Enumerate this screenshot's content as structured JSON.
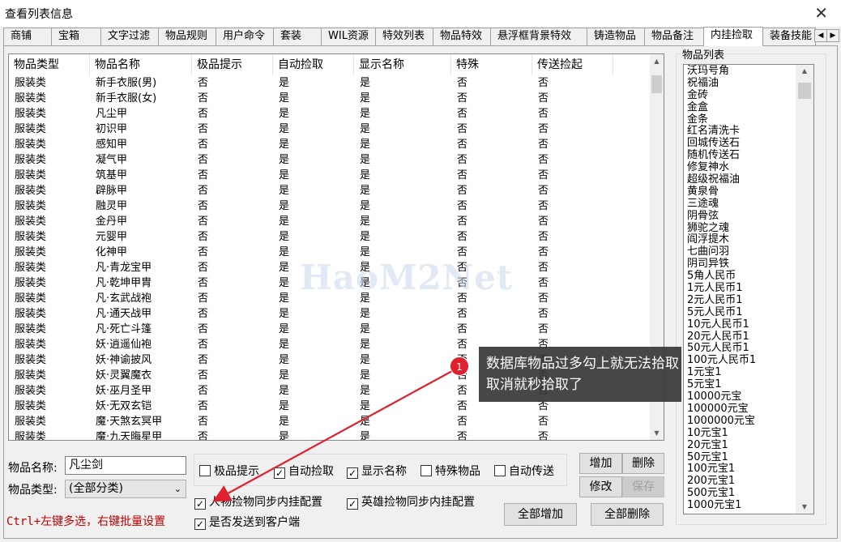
{
  "window": {
    "title": "查看列表信息",
    "close_glyph": "✕"
  },
  "tabs": [
    "商铺",
    "宝箱",
    "文字过滤",
    "物品规则",
    "用户命令",
    "套装",
    "WIL资源",
    "特效列表",
    "物品特效",
    "悬浮框背景特效",
    "铸造物品",
    "物品备注",
    "内挂捡取",
    "装备技能"
  ],
  "active_tab": "内挂捡取",
  "table": {
    "columns": [
      "物品类型",
      "物品名称",
      "极品提示",
      "自动捡取",
      "显示名称",
      "特殊",
      "传送捡起"
    ],
    "rows": [
      [
        "服装类",
        "新手衣服(男)",
        "否",
        "是",
        "是",
        "否",
        "否"
      ],
      [
        "服装类",
        "新手衣服(女)",
        "否",
        "是",
        "是",
        "否",
        "否"
      ],
      [
        "服装类",
        "凡尘甲",
        "否",
        "是",
        "是",
        "否",
        "否"
      ],
      [
        "服装类",
        "初识甲",
        "否",
        "是",
        "是",
        "否",
        "否"
      ],
      [
        "服装类",
        "感知甲",
        "否",
        "是",
        "是",
        "否",
        "否"
      ],
      [
        "服装类",
        "凝气甲",
        "否",
        "是",
        "是",
        "否",
        "否"
      ],
      [
        "服装类",
        "筑基甲",
        "否",
        "是",
        "是",
        "否",
        "否"
      ],
      [
        "服装类",
        "辟脉甲",
        "否",
        "是",
        "是",
        "否",
        "否"
      ],
      [
        "服装类",
        "融灵甲",
        "否",
        "是",
        "是",
        "否",
        "否"
      ],
      [
        "服装类",
        "金丹甲",
        "否",
        "是",
        "是",
        "否",
        "否"
      ],
      [
        "服装类",
        "元婴甲",
        "否",
        "是",
        "是",
        "否",
        "否"
      ],
      [
        "服装类",
        "化神甲",
        "否",
        "是",
        "是",
        "否",
        "否"
      ],
      [
        "服装类",
        "凡·青龙宝甲",
        "否",
        "是",
        "是",
        "否",
        "否"
      ],
      [
        "服装类",
        "凡·乾坤甲胄",
        "否",
        "是",
        "是",
        "否",
        "否"
      ],
      [
        "服装类",
        "凡·玄武战袍",
        "否",
        "是",
        "是",
        "否",
        "否"
      ],
      [
        "服装类",
        "凡·通天战甲",
        "否",
        "是",
        "是",
        "否",
        "否"
      ],
      [
        "服装类",
        "凡·死亡斗篷",
        "否",
        "是",
        "是",
        "否",
        "否"
      ],
      [
        "服装类",
        "妖·逍遥仙袍",
        "否",
        "是",
        "是",
        "否",
        "否"
      ],
      [
        "服装类",
        "妖·神谕披风",
        "否",
        "是",
        "是",
        "否",
        "否"
      ],
      [
        "服装类",
        "妖·灵翼魔衣",
        "否",
        "是",
        "是",
        "否",
        "否"
      ],
      [
        "服装类",
        "妖·巫月圣甲",
        "否",
        "是",
        "是",
        "否",
        "否"
      ],
      [
        "服装类",
        "妖·无双玄铠",
        "否",
        "是",
        "是",
        "否",
        "否"
      ],
      [
        "服装类",
        "魔·天煞玄冥甲",
        "否",
        "是",
        "是",
        "否",
        "否"
      ],
      [
        "服装类",
        "魔·九天晦星甲",
        "否",
        "是",
        "是",
        "否",
        "否"
      ]
    ]
  },
  "item_list": {
    "title": "物品列表",
    "items": [
      "沃玛号角",
      "祝福油",
      "金砖",
      "金盒",
      "金条",
      "红名清洗卡",
      "回城传送石",
      "随机传送石",
      "修复神水",
      "超级祝福油",
      "黄泉骨",
      "三途魂",
      "阴骨弦",
      "狮驼之魂",
      "阎浮提木",
      "七曲问羽",
      "阴司异铁",
      "5角人民币",
      "1元人民币1",
      "2元人民币1",
      "5元人民币1",
      "10元人民币1",
      "20元人民币1",
      "50元人民币1",
      "100元人民币1",
      "1元宝1",
      "5元宝1",
      "10000元宝",
      "100000元宝",
      "1000000元宝",
      "10元宝1",
      "20元宝1",
      "50元宝1",
      "100元宝1",
      "200元宝1",
      "500元宝1",
      "1000元宝1"
    ]
  },
  "form": {
    "name_label": "物品名称:",
    "name_value": "凡尘剑",
    "type_label": "物品类型:",
    "type_value": "(全部分类)"
  },
  "checkboxes": {
    "premium_hint": {
      "label": "极品提示",
      "checked": false
    },
    "auto_pick": {
      "label": "自动捡取",
      "checked": true
    },
    "show_name": {
      "label": "显示名称",
      "checked": true
    },
    "special": {
      "label": "特殊物品",
      "checked": false
    },
    "auto_teleport": {
      "label": "自动传送",
      "checked": false
    },
    "player_sync": {
      "label": "人物捡物同步内挂配置",
      "checked": true
    },
    "hero_sync": {
      "label": "英雄捡物同步内挂配置",
      "checked": true
    },
    "send_client": {
      "label": "是否发送到客户端",
      "checked": true
    }
  },
  "buttons": {
    "add": "增加",
    "delete": "删除",
    "modify": "修改",
    "save": "保存",
    "add_all": "全部增加",
    "delete_all": "全部删除"
  },
  "hint": "Ctrl+左键多选，右键批量设置",
  "annotation": {
    "badge": "1",
    "line1": "数据库物品过多勾上就无法拾取",
    "line2": "取消就秒拾取了"
  },
  "watermark": "HaoM2Net",
  "colors": {
    "hint": "#c00000",
    "badge": "#e0202e",
    "callout_bg": "#373737"
  }
}
